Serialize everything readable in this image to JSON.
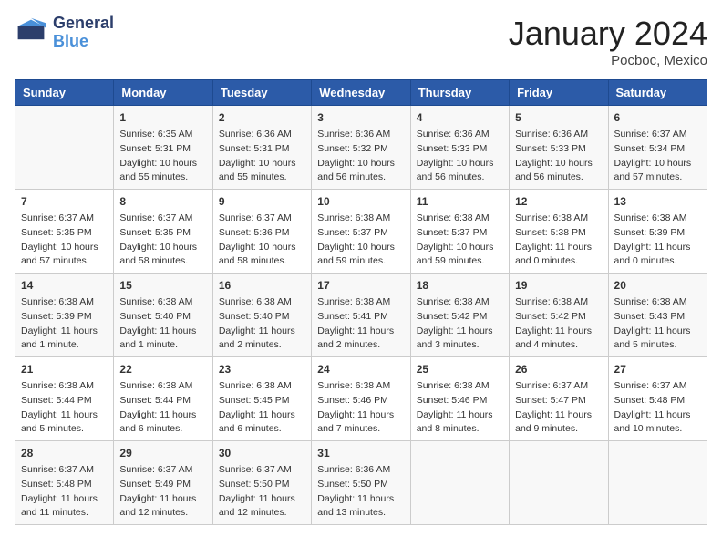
{
  "header": {
    "logo_line1": "General",
    "logo_line2": "Blue",
    "month": "January 2024",
    "location": "Pocboc, Mexico"
  },
  "days_of_week": [
    "Sunday",
    "Monday",
    "Tuesday",
    "Wednesday",
    "Thursday",
    "Friday",
    "Saturday"
  ],
  "weeks": [
    [
      {
        "day": "",
        "content": ""
      },
      {
        "day": "1",
        "content": "Sunrise: 6:35 AM\nSunset: 5:31 PM\nDaylight: 10 hours\nand 55 minutes."
      },
      {
        "day": "2",
        "content": "Sunrise: 6:36 AM\nSunset: 5:31 PM\nDaylight: 10 hours\nand 55 minutes."
      },
      {
        "day": "3",
        "content": "Sunrise: 6:36 AM\nSunset: 5:32 PM\nDaylight: 10 hours\nand 56 minutes."
      },
      {
        "day": "4",
        "content": "Sunrise: 6:36 AM\nSunset: 5:33 PM\nDaylight: 10 hours\nand 56 minutes."
      },
      {
        "day": "5",
        "content": "Sunrise: 6:36 AM\nSunset: 5:33 PM\nDaylight: 10 hours\nand 56 minutes."
      },
      {
        "day": "6",
        "content": "Sunrise: 6:37 AM\nSunset: 5:34 PM\nDaylight: 10 hours\nand 57 minutes."
      }
    ],
    [
      {
        "day": "7",
        "content": "Sunrise: 6:37 AM\nSunset: 5:35 PM\nDaylight: 10 hours\nand 57 minutes."
      },
      {
        "day": "8",
        "content": "Sunrise: 6:37 AM\nSunset: 5:35 PM\nDaylight: 10 hours\nand 58 minutes."
      },
      {
        "day": "9",
        "content": "Sunrise: 6:37 AM\nSunset: 5:36 PM\nDaylight: 10 hours\nand 58 minutes."
      },
      {
        "day": "10",
        "content": "Sunrise: 6:38 AM\nSunset: 5:37 PM\nDaylight: 10 hours\nand 59 minutes."
      },
      {
        "day": "11",
        "content": "Sunrise: 6:38 AM\nSunset: 5:37 PM\nDaylight: 10 hours\nand 59 minutes."
      },
      {
        "day": "12",
        "content": "Sunrise: 6:38 AM\nSunset: 5:38 PM\nDaylight: 11 hours\nand 0 minutes."
      },
      {
        "day": "13",
        "content": "Sunrise: 6:38 AM\nSunset: 5:39 PM\nDaylight: 11 hours\nand 0 minutes."
      }
    ],
    [
      {
        "day": "14",
        "content": "Sunrise: 6:38 AM\nSunset: 5:39 PM\nDaylight: 11 hours\nand 1 minute."
      },
      {
        "day": "15",
        "content": "Sunrise: 6:38 AM\nSunset: 5:40 PM\nDaylight: 11 hours\nand 1 minute."
      },
      {
        "day": "16",
        "content": "Sunrise: 6:38 AM\nSunset: 5:40 PM\nDaylight: 11 hours\nand 2 minutes."
      },
      {
        "day": "17",
        "content": "Sunrise: 6:38 AM\nSunset: 5:41 PM\nDaylight: 11 hours\nand 2 minutes."
      },
      {
        "day": "18",
        "content": "Sunrise: 6:38 AM\nSunset: 5:42 PM\nDaylight: 11 hours\nand 3 minutes."
      },
      {
        "day": "19",
        "content": "Sunrise: 6:38 AM\nSunset: 5:42 PM\nDaylight: 11 hours\nand 4 minutes."
      },
      {
        "day": "20",
        "content": "Sunrise: 6:38 AM\nSunset: 5:43 PM\nDaylight: 11 hours\nand 5 minutes."
      }
    ],
    [
      {
        "day": "21",
        "content": "Sunrise: 6:38 AM\nSunset: 5:44 PM\nDaylight: 11 hours\nand 5 minutes."
      },
      {
        "day": "22",
        "content": "Sunrise: 6:38 AM\nSunset: 5:44 PM\nDaylight: 11 hours\nand 6 minutes."
      },
      {
        "day": "23",
        "content": "Sunrise: 6:38 AM\nSunset: 5:45 PM\nDaylight: 11 hours\nand 6 minutes."
      },
      {
        "day": "24",
        "content": "Sunrise: 6:38 AM\nSunset: 5:46 PM\nDaylight: 11 hours\nand 7 minutes."
      },
      {
        "day": "25",
        "content": "Sunrise: 6:38 AM\nSunset: 5:46 PM\nDaylight: 11 hours\nand 8 minutes."
      },
      {
        "day": "26",
        "content": "Sunrise: 6:37 AM\nSunset: 5:47 PM\nDaylight: 11 hours\nand 9 minutes."
      },
      {
        "day": "27",
        "content": "Sunrise: 6:37 AM\nSunset: 5:48 PM\nDaylight: 11 hours\nand 10 minutes."
      }
    ],
    [
      {
        "day": "28",
        "content": "Sunrise: 6:37 AM\nSunset: 5:48 PM\nDaylight: 11 hours\nand 11 minutes."
      },
      {
        "day": "29",
        "content": "Sunrise: 6:37 AM\nSunset: 5:49 PM\nDaylight: 11 hours\nand 12 minutes."
      },
      {
        "day": "30",
        "content": "Sunrise: 6:37 AM\nSunset: 5:50 PM\nDaylight: 11 hours\nand 12 minutes."
      },
      {
        "day": "31",
        "content": "Sunrise: 6:36 AM\nSunset: 5:50 PM\nDaylight: 11 hours\nand 13 minutes."
      },
      {
        "day": "",
        "content": ""
      },
      {
        "day": "",
        "content": ""
      },
      {
        "day": "",
        "content": ""
      }
    ]
  ]
}
